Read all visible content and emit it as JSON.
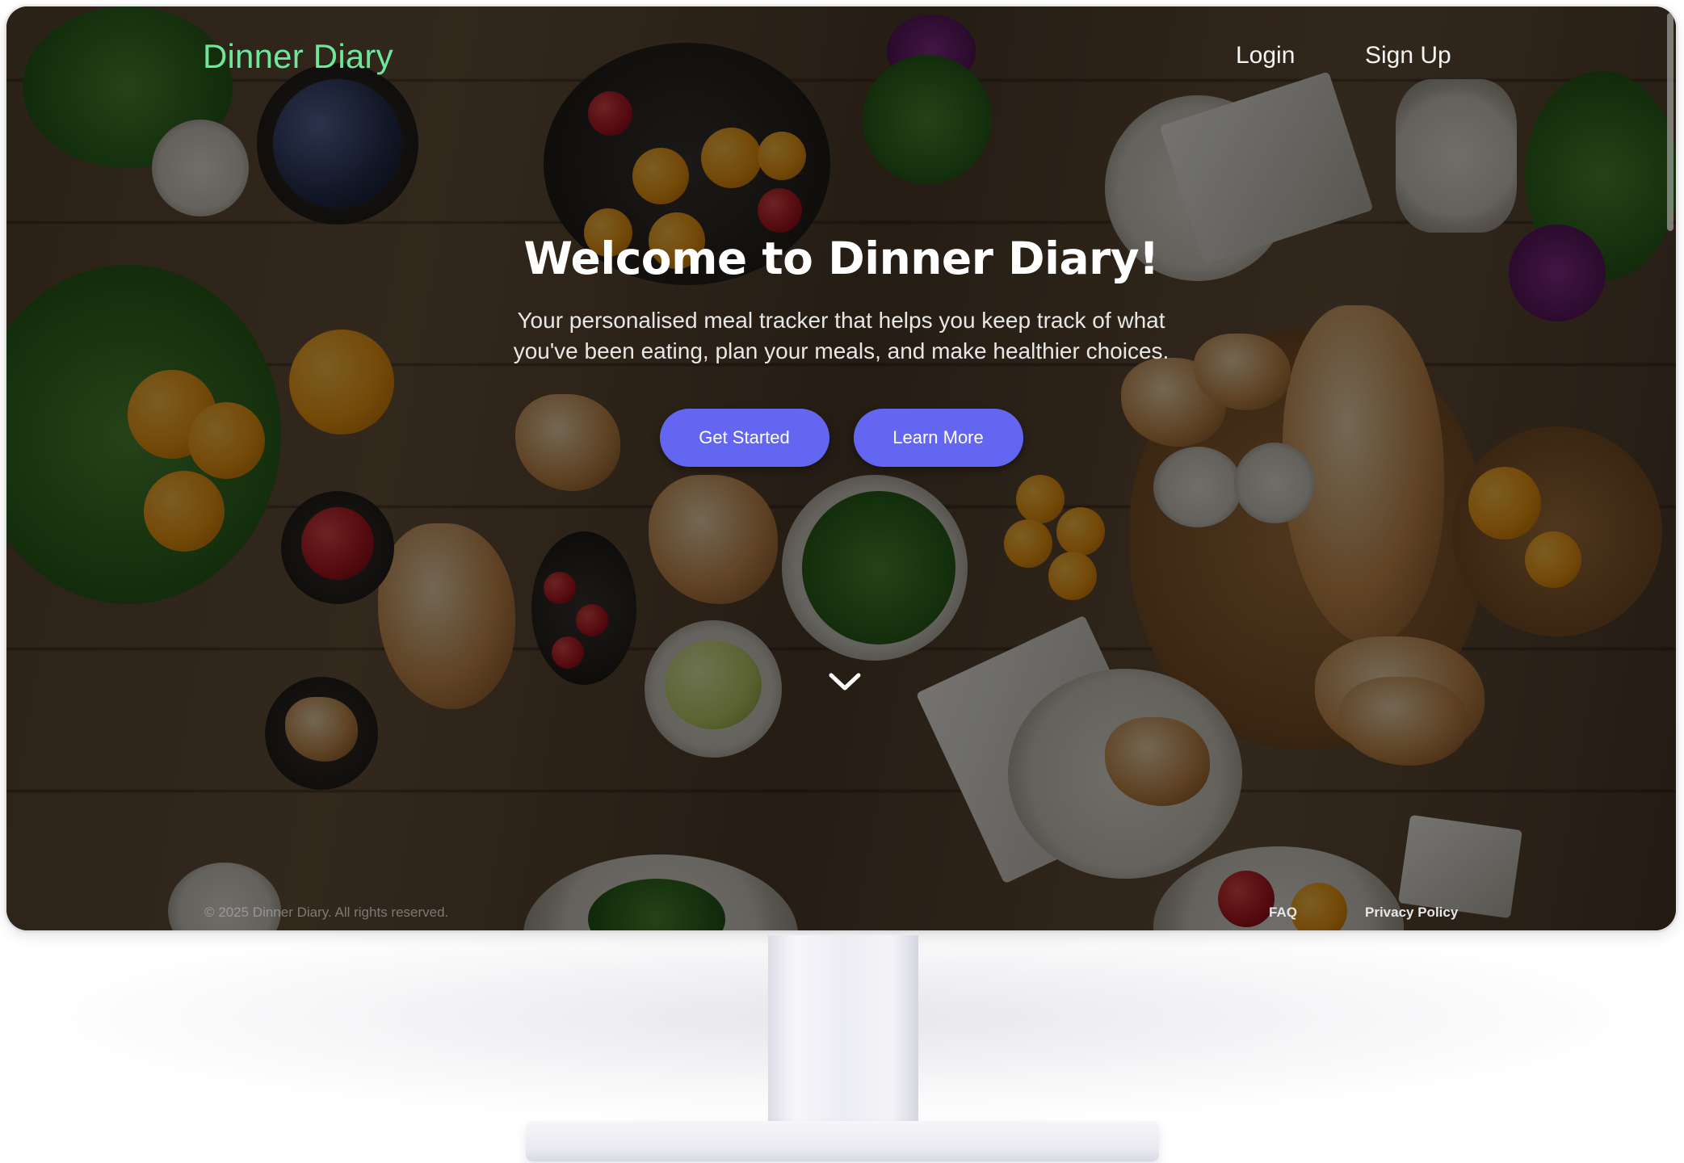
{
  "nav": {
    "brand": "Dinner Diary",
    "login": "Login",
    "signup": "Sign Up"
  },
  "hero": {
    "title": "Welcome to Dinner Diary!",
    "subtitle": "Your personalised meal tracker that helps you keep track of what you've been eating, plan your meals, and make healthier choices.",
    "primary_button": "Get Started",
    "secondary_button": "Learn More"
  },
  "scroll_hint": {
    "icon": "chevron-down-icon"
  },
  "footer": {
    "copyright": "© 2025 Dinner Diary. All rights reserved.",
    "faq": "FAQ",
    "privacy": "Privacy Policy"
  },
  "colors": {
    "brand": "#6ee79b",
    "button": "#6366f1",
    "overlay": "rgba(0,0,0,0.52)"
  }
}
